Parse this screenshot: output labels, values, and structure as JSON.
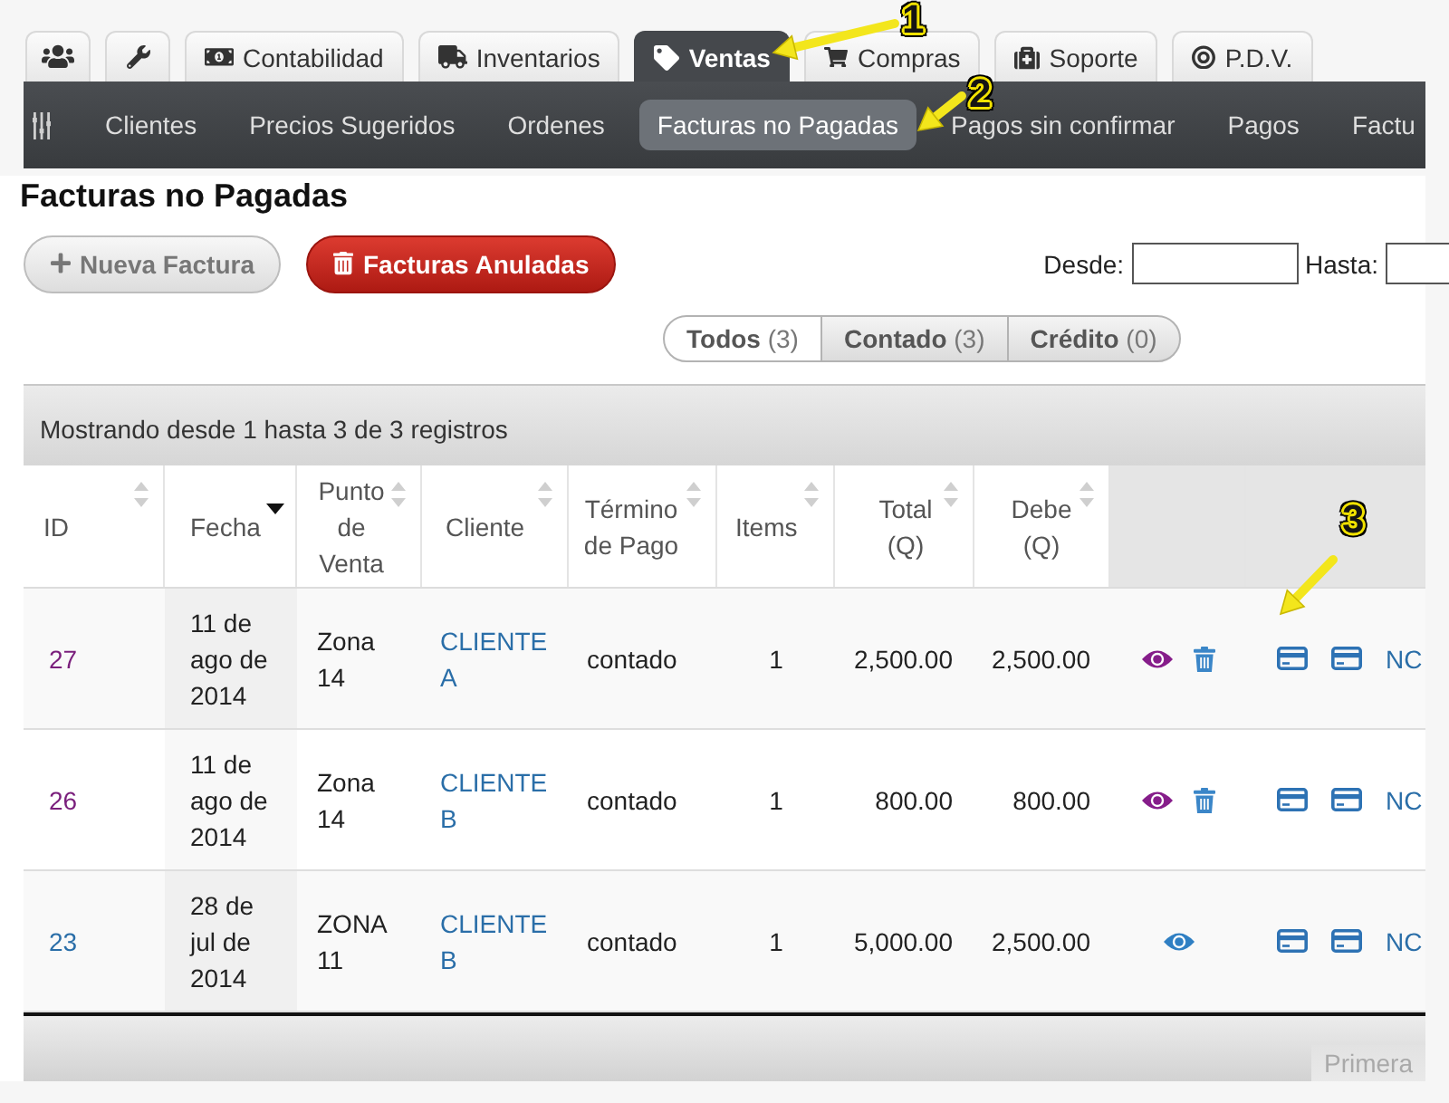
{
  "top_tabs": [
    {
      "selected": false
    },
    {
      "selected": false
    },
    {
      "label": "Contabilidad",
      "selected": false
    },
    {
      "label": "Inventarios",
      "selected": false
    },
    {
      "label": "Ventas",
      "selected": true
    },
    {
      "label": "Compras",
      "selected": false
    },
    {
      "label": "Soporte",
      "selected": false
    },
    {
      "label": "P.D.V.",
      "selected": false
    }
  ],
  "nav": {
    "items": [
      {
        "label": "Clientes",
        "selected": false
      },
      {
        "label": "Precios Sugeridos",
        "selected": false
      },
      {
        "label": "Ordenes",
        "selected": false
      },
      {
        "label": "Facturas no Pagadas",
        "selected": true
      },
      {
        "label": "Pagos sin confirmar",
        "selected": false
      },
      {
        "label": "Pagos",
        "selected": false
      },
      {
        "label": "Factu",
        "selected": false
      }
    ]
  },
  "page_title": "Facturas no Pagadas",
  "actions": [
    {
      "label": "Nueva Factura",
      "kind": "default"
    },
    {
      "label": "Facturas Anuladas",
      "kind": "danger"
    }
  ],
  "date_filters": [
    {
      "label": "Desde:"
    },
    {
      "label": "Hasta:"
    }
  ],
  "payment_filter": [
    {
      "label": "Todos",
      "count": "(3)",
      "selected": true
    },
    {
      "label": "Contado",
      "count": "(3)",
      "selected": false
    },
    {
      "label": "Crédito",
      "count": "(0)",
      "selected": false
    }
  ],
  "table": {
    "info": "Mostrando desde 1 hasta 3 de 3 registros",
    "columns": [
      {
        "kind": "data",
        "label": "ID",
        "sortable": true,
        "sorted": false
      },
      {
        "kind": "data",
        "label": "Fecha",
        "sortable": true,
        "sorted": true
      },
      {
        "kind": "data",
        "label": "Punto de Venta",
        "sortable": true,
        "sorted": false
      },
      {
        "kind": "data",
        "label": "Cliente",
        "sortable": true,
        "sorted": false
      },
      {
        "kind": "data",
        "label": "Término de Pago",
        "sortable": true,
        "sorted": false
      },
      {
        "kind": "data",
        "label": "Items",
        "sortable": true,
        "sorted": false
      },
      {
        "kind": "data",
        "label": "Total (Q)",
        "sortable": true,
        "sorted": false
      },
      {
        "kind": "data",
        "label": "Debe (Q)",
        "sortable": true,
        "sorted": false
      },
      {
        "kind": "actions",
        "sortable": false,
        "sorted": false
      },
      {
        "kind": "actions",
        "sortable": false,
        "sorted": false
      }
    ],
    "rows": [
      {
        "id": "27",
        "visited": true,
        "date": "11 de ago de 2014",
        "point": "Zona 14",
        "client": "CLIENTE A",
        "term": "contado",
        "items": "1",
        "total": "2,500.00",
        "due": "2,500.00",
        "can_delete": true,
        "credit_note": "NC"
      },
      {
        "id": "26",
        "visited": true,
        "date": "11 de ago de 2014",
        "point": "Zona 14",
        "client": "CLIENTE B",
        "term": "contado",
        "items": "1",
        "total": "800.00",
        "due": "800.00",
        "can_delete": true,
        "credit_note": "NC"
      },
      {
        "id": "23",
        "visited": false,
        "date": "28 de jul de 2014",
        "point": "ZONA 11",
        "client": "CLIENTE B",
        "term": "contado",
        "items": "1",
        "total": "5,000.00",
        "due": "2,500.00",
        "can_delete": false,
        "credit_note": "NC"
      }
    ],
    "pagination": [
      {
        "label": "Primera",
        "disabled": true
      }
    ]
  },
  "annotations": [
    {
      "number": "1"
    },
    {
      "number": "2"
    },
    {
      "number": "3"
    }
  ]
}
